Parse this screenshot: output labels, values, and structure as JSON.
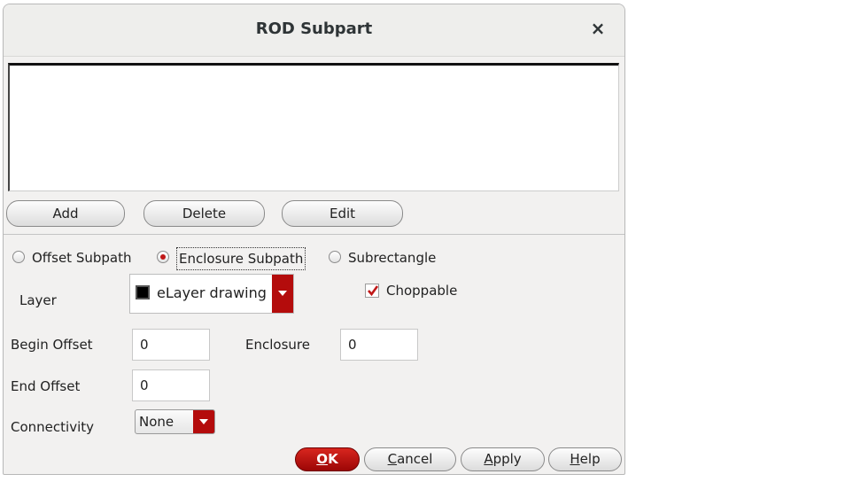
{
  "window": {
    "title": "ROD Subpart",
    "close_glyph": "×"
  },
  "list_buttons": {
    "add": "Add",
    "delete": "Delete",
    "edit": "Edit"
  },
  "subpart_type": {
    "options": [
      {
        "label": "Offset Subpath",
        "selected": false
      },
      {
        "label": "Enclosure Subpath",
        "selected": true
      },
      {
        "label": "Subrectangle",
        "selected": false
      }
    ]
  },
  "form": {
    "layer_label": "Layer",
    "layer_value": "eLayer drawing",
    "layer_swatch_color": "#000000",
    "choppable_label": "Choppable",
    "choppable_checked": true,
    "begin_offset_label": "Begin Offset",
    "begin_offset_value": "0",
    "enclosure_label": "Enclosure",
    "enclosure_value": "0",
    "end_offset_label": "End Offset",
    "end_offset_value": "0",
    "connectivity_label": "Connectivity",
    "connectivity_value": "None"
  },
  "footer": {
    "ok": {
      "mnemonic": "O",
      "rest": "K"
    },
    "cancel": {
      "mnemonic": "C",
      "rest": "ancel"
    },
    "apply": {
      "mnemonic": "A",
      "rest": "pply"
    },
    "help": {
      "mnemonic": "H",
      "rest": "elp"
    }
  },
  "colors": {
    "accent": "#b40c0c",
    "dialog_bg": "#f2f1f0"
  }
}
